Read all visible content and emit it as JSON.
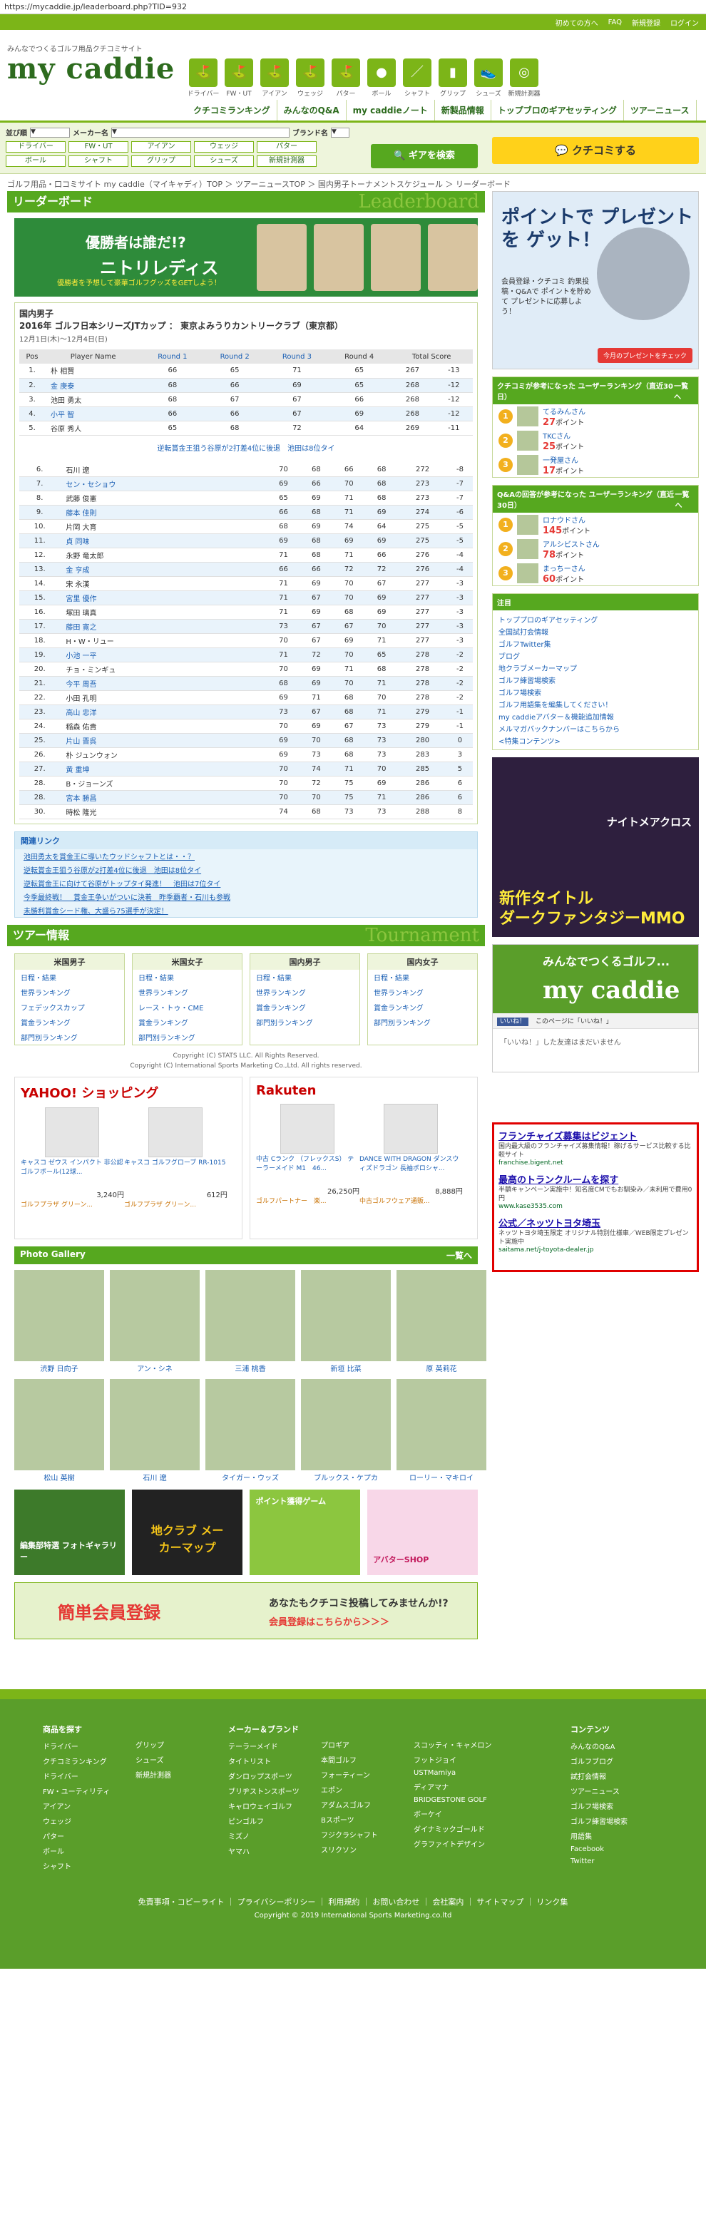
{
  "url": "https://mycaddie.jp/leaderboard.php?TID=932",
  "topstrip": [
    "初めての方へ",
    "FAQ",
    "新規登録",
    "ログイン"
  ],
  "logo": {
    "tagline": "みんなでつくるゴルフ用品クチコミサイト",
    "brand": "my caddie"
  },
  "categories": [
    "ドライバー",
    "FW・UT",
    "アイアン",
    "ウェッジ",
    "パター",
    "ボール",
    "シャフト",
    "グリップ",
    "シューズ",
    "新規計測器"
  ],
  "mainnav": [
    "クチコミランキング",
    "みんなのQ&A",
    "my caddieノート",
    "新製品情報",
    "トップブロのギアセッティング",
    "ツアーニュース"
  ],
  "search": {
    "order_label": "並び順",
    "maker_label": "メーカー名",
    "brand_label": "ブランド名",
    "chips_row1": [
      "ドライバー",
      "FW・UT",
      "アイアン",
      "ウェッジ",
      "パター"
    ],
    "chips_row2": [
      "ボール",
      "シャフト",
      "グリップ",
      "シューズ",
      "新規計測器"
    ],
    "gear_button": "ギアを検索",
    "kuchikomi_button": "クチコミする"
  },
  "breadcrumb": "ゴルフ用品・口コミサイト my caddie（マイキャディ）TOP ＞ ツアーニュースTOP ＞ 国内男子トーナメントスケジュール ＞ リーダーボード",
  "leaderboard": {
    "title": "リーダーボード",
    "title_en": "Leaderboard",
    "banner": {
      "t1": "優勝者は誰だ!?",
      "t2": "ニトリレディス",
      "t3": "優勝者を予想して豪華ゴルフグッズをGETしよう！"
    },
    "tour_category": "国内男子",
    "tour_name": "2016年 ゴルフ日本シリーズJTカップ ： 東京よみうりカントリークラブ（東京都）",
    "tour_date": "12月1日(木)〜12月4日(日)",
    "headers": [
      "Pos",
      "Player Name",
      "Round 1",
      "Round 2",
      "Round 3",
      "Round 4",
      "Total Score"
    ],
    "rows_top": [
      [
        "1.",
        "朴 相賢",
        "66",
        "65",
        "71",
        "65",
        "267",
        "-13"
      ],
      [
        "2.",
        "金 庚泰",
        "68",
        "66",
        "69",
        "65",
        "268",
        "-12"
      ],
      [
        "3.",
        "池田 勇太",
        "68",
        "67",
        "67",
        "66",
        "268",
        "-12"
      ],
      [
        "4.",
        "小平 智",
        "66",
        "66",
        "67",
        "69",
        "268",
        "-12"
      ],
      [
        "5.",
        "谷原 秀人",
        "65",
        "68",
        "72",
        "64",
        "269",
        "-11"
      ]
    ],
    "tie_note": "逆転賞金王狙う谷原が2打差4位に後退　池田は8位タイ",
    "rows_bottom": [
      [
        "6.",
        "石川 遼",
        "70",
        "68",
        "66",
        "68",
        "272",
        "-8"
      ],
      [
        "7.",
        "セン・セショウ",
        "69",
        "66",
        "70",
        "68",
        "273",
        "-7"
      ],
      [
        "8.",
        "武藤 俊憲",
        "65",
        "69",
        "71",
        "68",
        "273",
        "-7"
      ],
      [
        "9.",
        "藤本 佳則",
        "66",
        "68",
        "71",
        "69",
        "274",
        "-6"
      ],
      [
        "10.",
        "片岡 大育",
        "68",
        "69",
        "74",
        "64",
        "275",
        "-5"
      ],
      [
        "11.",
        "貞 同味",
        "69",
        "68",
        "69",
        "69",
        "275",
        "-5"
      ],
      [
        "12.",
        "永野 竜太郎",
        "71",
        "68",
        "71",
        "66",
        "276",
        "-4"
      ],
      [
        "13.",
        "金 亨成",
        "66",
        "66",
        "72",
        "72",
        "276",
        "-4"
      ],
      [
        "14.",
        "宋 永漢",
        "71",
        "69",
        "70",
        "67",
        "277",
        "-3"
      ],
      [
        "15.",
        "宮里 優作",
        "71",
        "67",
        "70",
        "69",
        "277",
        "-3"
      ],
      [
        "16.",
        "塚田 璃真",
        "71",
        "69",
        "68",
        "69",
        "277",
        "-3"
      ],
      [
        "17.",
        "藤田 寛之",
        "73",
        "67",
        "67",
        "70",
        "277",
        "-3"
      ],
      [
        "18.",
        "H・W・リュー",
        "70",
        "67",
        "69",
        "71",
        "277",
        "-3"
      ],
      [
        "19.",
        "小池 一平",
        "71",
        "72",
        "70",
        "65",
        "278",
        "-2"
      ],
      [
        "20.",
        "チョ・ミンギュ",
        "70",
        "69",
        "71",
        "68",
        "278",
        "-2"
      ],
      [
        "21.",
        "今平 周吾",
        "68",
        "69",
        "70",
        "71",
        "278",
        "-2"
      ],
      [
        "22.",
        "小田 孔明",
        "69",
        "71",
        "68",
        "70",
        "278",
        "-2"
      ],
      [
        "23.",
        "高山 忠洋",
        "73",
        "67",
        "68",
        "71",
        "279",
        "-1"
      ],
      [
        "24.",
        "稲森 佑貴",
        "70",
        "69",
        "67",
        "73",
        "279",
        "-1"
      ],
      [
        "25.",
        "片山 晋呉",
        "69",
        "70",
        "68",
        "73",
        "280",
        "0"
      ],
      [
        "26.",
        "朴 ジュンウォン",
        "69",
        "73",
        "68",
        "73",
        "283",
        "3"
      ],
      [
        "27.",
        "黄 重坤",
        "70",
        "74",
        "71",
        "70",
        "285",
        "5"
      ],
      [
        "28.",
        "B・ジョーンズ",
        "70",
        "72",
        "75",
        "69",
        "286",
        "6"
      ],
      [
        "28.",
        "宮本 勝昌",
        "70",
        "70",
        "75",
        "71",
        "286",
        "6"
      ],
      [
        "30.",
        "時松 隆光",
        "74",
        "68",
        "73",
        "73",
        "288",
        "8"
      ]
    ]
  },
  "related": {
    "title": "関連リンク",
    "links": [
      "池田勇太を賞金王に導いたウッドシャフトとは・・？",
      "逆転賞金王狙う谷原が2打差4位に後退　池田は8位タイ",
      "逆転賞金王に向けて谷原がトップタイ発進！　池田は7位タイ",
      "今季最終戦！　賞金王争いがついに決着　昨季覇者・石川も参戦",
      "未勝利賞金シード権、大盛ら75選手が決定！"
    ]
  },
  "tour": {
    "title": "ツアー情報",
    "title_en": "Tournament",
    "columns": [
      {
        "name": "米国男子",
        "items": [
          "日程・結果",
          "世界ランキング",
          "フェデックスカップ",
          "賞金ランキング",
          "部門別ランキング"
        ]
      },
      {
        "name": "米国女子",
        "items": [
          "日程・結果",
          "世界ランキング",
          "レース・トゥ・CME",
          "賞金ランキング",
          "部門別ランキング"
        ]
      },
      {
        "name": "国内男子",
        "items": [
          "日程・結果",
          "世界ランキング",
          "賞金ランキング",
          "部門別ランキング"
        ]
      },
      {
        "name": "国内女子",
        "items": [
          "日程・結果",
          "世界ランキング",
          "賞金ランキング",
          "部門別ランキング"
        ]
      }
    ],
    "copy1": "Copyright (C) STATS LLC. All Rights Reserved.",
    "copy2": "Copyright (C) International Sports Marketing Co.,Ltd. All rights reserved."
  },
  "shops": {
    "yahoo": {
      "logo": "YAHOO! ショッピング",
      "products": [
        {
          "name": "キャスコ ゼウス インパクト 非公認 ゴルフボール(12球...",
          "price": "3,240円",
          "store": "ゴルフプラザ グリーン..."
        },
        {
          "name": "キャスコ ゴルフグローブ RR-1015",
          "price": "612円",
          "store": "ゴルフプラザ グリーン..."
        }
      ]
    },
    "rakuten": {
      "logo": "Rakuten",
      "products": [
        {
          "name": "中古 Cランク （フレックスS） テーラーメイド M1　46...",
          "price": "26,250円",
          "store": "ゴルフパートナー　楽..."
        },
        {
          "name": "DANCE WITH DRAGON ダンスウィズドラゴン 長袖ボロシャ...",
          "price": "8,888円",
          "store": "中古ゴルフウェア通販..."
        }
      ]
    }
  },
  "gallery": {
    "title": "Photo Gallery",
    "more": "一覧へ",
    "row1": [
      "渋野 日向子",
      "アン・シネ",
      "三浦 桃香",
      "新垣 比菜",
      "原 英莉花"
    ],
    "row2": [
      "松山 英樹",
      "石川 遼",
      "タイガー・ウッズ",
      "ブルックス・ケプカ",
      "ローリー・マキロイ"
    ]
  },
  "promos": [
    "編集部特選 フォトギャラリー",
    "地クラブ メーカーマップ",
    "ポイント獲得ゲーム",
    "アバターSHOP"
  ],
  "register": {
    "a": "簡単会員登録",
    "b": "あなたもクチコミ投稿してみませんか!?",
    "c": "会員登録はこちらから＞＞＞"
  },
  "right": {
    "ad": {
      "title": "ポイントで プレゼントを ゲット！",
      "sub": "会員登録・クチコミ 釣果投稿・Q&Aで ポイントを貯めて プレゼントに応募しよう！",
      "button": "今月のプレゼントをチェック"
    },
    "rank1": {
      "title": "クチコミが参考になった ユーザーランキング（直近30日）",
      "more": "一覧へ",
      "users": [
        {
          "rank": "1",
          "name": "てるみんさん",
          "points": "27",
          "unit": "ポイント"
        },
        {
          "rank": "2",
          "name": "TKCさん",
          "points": "25",
          "unit": "ポイント"
        },
        {
          "rank": "3",
          "name": "一発屋さん",
          "points": "17",
          "unit": "ポイント"
        }
      ]
    },
    "rank2": {
      "title": "Q&Aの回答が参考になった ユーザーランキング（直近30日）",
      "more": "一覧へ",
      "users": [
        {
          "rank": "1",
          "name": "ロナウドさん",
          "points": "145",
          "unit": "ポイント"
        },
        {
          "rank": "2",
          "name": "アルシビストさん",
          "points": "78",
          "unit": "ポイント"
        },
        {
          "rank": "3",
          "name": "まっちーさん",
          "points": "60",
          "unit": "ポイント"
        }
      ]
    },
    "notice": {
      "title": "注目",
      "items": [
        "トッププロのギアセッティング",
        "全国試打会情報",
        "ゴルフTwitter集",
        "ブログ",
        "地クラブメーカーマップ",
        "ゴルフ練習場検索",
        "ゴルフ場検索",
        "ゴルフ用語集を編集してください！",
        "my caddieアバター＆機能追加情報",
        "メルマガバックナンバーはこちらから",
        "<特集コンテンツ>"
      ]
    },
    "game": {
      "t1": "ナイトメアクロス",
      "t2": "新作タイトル",
      "t3": "ダークファンタジーMMO"
    },
    "fb": {
      "a": "みんなでつくるゴルフ...",
      "b": "my caddie",
      "like": "いいね！",
      "like_text": "このページに「いいね！」",
      "msg": "「いいね！」した友達はまだいません"
    },
    "ads": [
      {
        "title": "フランチャイズ募集はビジェント",
        "desc": "国内最大級のフランチャイズ募集情報！稼げるサービス比較する比較サイト",
        "url": "franchise.bigent.net"
      },
      {
        "title": "最高のトランクルームを探す",
        "desc": "半額キャンペーン実施中！知名度CMでもお馴染み／未利用で費用0円",
        "url": "www.kase3535.com"
      },
      {
        "title": "公式／ネッツトヨタ埼玉",
        "desc": "ネッツトヨタ埼玉限定 オリジナル特別仕様車／WEB限定プレゼント実施中",
        "url": "saitama.net/j-toyota-dealer.jp"
      }
    ]
  },
  "footer": {
    "col1_title": "商品を探す",
    "col1": [
      "ドライバー",
      "クチコミランキング",
      "ドライバー",
      "FW・ユーティリティ",
      "アイアン",
      "ウェッジ",
      "パター",
      "ボール",
      "シャフト"
    ],
    "col2": [
      "グリップ",
      "シューズ",
      "新規計測器"
    ],
    "col3_title": "メーカー＆ブランド",
    "col3": [
      "テーラーメイド",
      "タイトリスト",
      "ダンロップスポーツ",
      "ブリヂストンスポーツ",
      "キャロウェイゴルフ",
      "ピンゴルフ",
      "ミズノ",
      "ヤマハ"
    ],
    "col4": [
      "プロギア",
      "本間ゴルフ",
      "フォーティーン",
      "エポン",
      "アダムスゴルフ",
      "Bスポーツ",
      "フジクラシャフト",
      "スリクソン"
    ],
    "col5": [
      "スコッティ・キャメロン",
      "フットジョイ",
      "USTMamiya",
      "ディアマナ",
      "BRIDGESTONE GOLF",
      "ボーケイ",
      "ダイナミックゴールド",
      "グラファイトデザイン"
    ],
    "col6_title": "コンテンツ",
    "col6": [
      "みんなのQ&A",
      "ゴルフブログ",
      "試打会情報",
      "ツアーニュース",
      "ゴルフ場検索",
      "ゴルフ練習場検索",
      "用語集",
      "Facebook",
      "Twitter"
    ],
    "links": "免責事項・コピーライト ｜ プライバシーポリシー ｜ 利用規約 ｜ お問い合わせ ｜ 会社案内 ｜ サイトマップ ｜ リンク集",
    "copyright": "Copyright © 2019 International Sports Marketing.co.ltd"
  }
}
